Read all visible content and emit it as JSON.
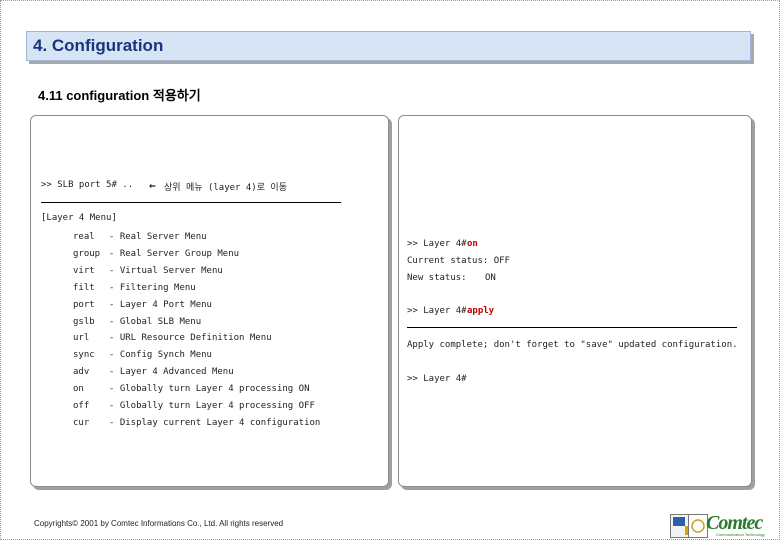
{
  "header": {
    "title": "4. Configuration"
  },
  "subtitle": "4.11 configuration 적용하기",
  "left_panel": {
    "prompt": ">> SLB port 5# ..",
    "arrow": "←",
    "note": "상위 메뉴 (layer 4)로 이동",
    "menu_header": "[Layer 4 Menu]",
    "menu": [
      {
        "cmd": "real",
        "desc": "- Real Server Menu"
      },
      {
        "cmd": "group",
        "desc": "- Real Server Group Menu"
      },
      {
        "cmd": "virt",
        "desc": "- Virtual Server Menu"
      },
      {
        "cmd": "filt",
        "desc": "- Filtering Menu"
      },
      {
        "cmd": "port",
        "desc": "- Layer 4 Port Menu"
      },
      {
        "cmd": "gslb",
        "desc": "- Global SLB Menu"
      },
      {
        "cmd": "url",
        "desc": "- URL Resource Definition Menu"
      },
      {
        "cmd": "sync",
        "desc": "- Config Synch Menu"
      },
      {
        "cmd": "adv",
        "desc": "- Layer 4 Advanced Menu"
      },
      {
        "cmd": "on",
        "desc": "- Globally turn Layer 4 processing ON"
      },
      {
        "cmd": "off",
        "desc": "- Globally turn Layer 4 processing OFF"
      },
      {
        "cmd": "cur",
        "desc": "- Display current Layer 4 configuration"
      }
    ]
  },
  "right_panel": {
    "prompt1": ">> Layer 4#",
    "cmd1": "on",
    "status_current": "Current status: OFF",
    "status_new_label": "New status:",
    "status_new_value": "ON",
    "prompt2": ">> Layer 4#",
    "cmd2": "apply",
    "apply_msg": "Apply complete; don't forget to \"save\" updated configuration.",
    "prompt3": ">> Layer 4#"
  },
  "footer": {
    "copyright": "Copyrights© 2001 by Comtec Informations Co., Ltd. All rights reserved"
  },
  "logo": {
    "text": "Comtec",
    "tagline": "Communication Technology"
  },
  "colors": {
    "header_bg": "#d6e4f6",
    "header_text": "#17367d",
    "command_highlight": "#c00000",
    "logo_green": "#2c7a2c"
  }
}
